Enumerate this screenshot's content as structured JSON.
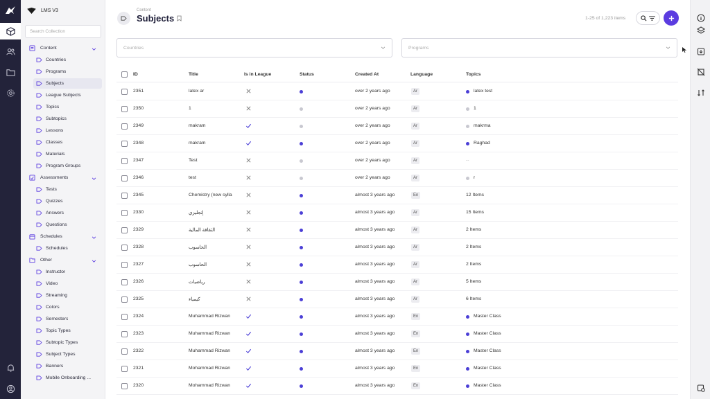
{
  "app": {
    "name": "LMS V3"
  },
  "search": {
    "placeholder": "Search Collection"
  },
  "sidebar": {
    "groups": [
      {
        "label": "Content",
        "items": [
          "Countries",
          "Programs",
          "Subjects",
          "League Subjects",
          "Topics",
          "Subtopics",
          "Lessons",
          "Classes",
          "Materials",
          "Program Groups"
        ]
      },
      {
        "label": "Assessments",
        "items": [
          "Tests",
          "Quizzes",
          "Answers",
          "Questions"
        ]
      },
      {
        "label": "Schedules",
        "items": [
          "Schedules"
        ]
      },
      {
        "label": "Other",
        "items": [
          "Instructor",
          "Video",
          "Streaming",
          "Colors",
          "Semesters",
          "Topic Types",
          "Subtopic Types",
          "Subject Types",
          "Banners",
          "Mobile Onboarding ..."
        ]
      }
    ],
    "active_item": "Subjects"
  },
  "header": {
    "breadcrumb": "Content",
    "title": "Subjects",
    "count": "1-25 of 1,223 items"
  },
  "filters": {
    "countries_placeholder": "Countries",
    "programs_placeholder": "Programs"
  },
  "table": {
    "columns": [
      "ID",
      "Title",
      "Is in League",
      "Status",
      "Created At",
      "Language",
      "Topics"
    ],
    "rows": [
      {
        "id": "2351",
        "title": "latex ar",
        "league": false,
        "status": "published",
        "created": "over 2 years ago",
        "lang": "Ar",
        "topics": "latex test",
        "topic_dot": "published"
      },
      {
        "id": "2350",
        "title": "1",
        "league": false,
        "status": "draft",
        "created": "over 2 years ago",
        "lang": "Ar",
        "topics": "1",
        "topic_dot": "draft"
      },
      {
        "id": "2349",
        "title": "makram",
        "league": true,
        "status": "draft",
        "created": "over 2 years ago",
        "lang": "Ar",
        "topics": "makrma",
        "topic_dot": "draft"
      },
      {
        "id": "2348",
        "title": "makram",
        "league": true,
        "status": "published",
        "created": "over 2 years ago",
        "lang": "Ar",
        "topics": "Raghad",
        "topic_dot": "published"
      },
      {
        "id": "2347",
        "title": "Test",
        "league": false,
        "status": "draft",
        "created": "over 2 years ago",
        "lang": "Ar",
        "topics": "--",
        "topic_dot": ""
      },
      {
        "id": "2346",
        "title": "test",
        "league": false,
        "status": "draft",
        "created": "over 2 years ago",
        "lang": "Ar",
        "topics": "r",
        "topic_dot": "draft"
      },
      {
        "id": "2345",
        "title": "Chemistry (new sylla",
        "league": false,
        "status": "published",
        "created": "almost 3 years ago",
        "lang": "En",
        "topics": "12 Items",
        "topic_dot": ""
      },
      {
        "id": "2330",
        "title": "إنجليزي",
        "league": false,
        "status": "published",
        "created": "almost 3 years ago",
        "lang": "Ar",
        "topics": "15 Items",
        "topic_dot": ""
      },
      {
        "id": "2329",
        "title": "الثقافة المالية",
        "league": false,
        "status": "published",
        "created": "almost 3 years ago",
        "lang": "Ar",
        "topics": "2 Items",
        "topic_dot": ""
      },
      {
        "id": "2328",
        "title": "الحاسوب",
        "league": false,
        "status": "published",
        "created": "almost 3 years ago",
        "lang": "Ar",
        "topics": "2 Items",
        "topic_dot": ""
      },
      {
        "id": "2327",
        "title": "الحاسوب",
        "league": false,
        "status": "published",
        "created": "almost 3 years ago",
        "lang": "Ar",
        "topics": "2 Items",
        "topic_dot": ""
      },
      {
        "id": "2326",
        "title": "رياضيات",
        "league": false,
        "status": "published",
        "created": "almost 3 years ago",
        "lang": "Ar",
        "topics": "5 Items",
        "topic_dot": ""
      },
      {
        "id": "2325",
        "title": "كيمياء",
        "league": false,
        "status": "published",
        "created": "almost 3 years ago",
        "lang": "Ar",
        "topics": "6 Items",
        "topic_dot": ""
      },
      {
        "id": "2324",
        "title": "Muhammad Rizwan",
        "league": true,
        "status": "published",
        "created": "almost 3 years ago",
        "lang": "En",
        "topics": "Master Class",
        "topic_dot": "published"
      },
      {
        "id": "2323",
        "title": "Muhammad Rizwan",
        "league": true,
        "status": "published",
        "created": "almost 3 years ago",
        "lang": "En",
        "topics": "Master Class",
        "topic_dot": "published"
      },
      {
        "id": "2322",
        "title": "Muhammad Rizwan",
        "league": true,
        "status": "published",
        "created": "almost 3 years ago",
        "lang": "En",
        "topics": "Master Class",
        "topic_dot": "published"
      },
      {
        "id": "2321",
        "title": "Mohammad Rizwan",
        "league": true,
        "status": "published",
        "created": "almost 3 years ago",
        "lang": "En",
        "topics": "Master Class",
        "topic_dot": "published"
      },
      {
        "id": "2320",
        "title": "Mohammad Rizwan",
        "league": true,
        "status": "published",
        "created": "almost 3 years ago",
        "lang": "En",
        "topics": "Master Class",
        "topic_dot": "published"
      }
    ]
  },
  "colors": {
    "accent": "#5b3ce0",
    "published": "#4b3fd6",
    "draft": "#c8c8d0"
  }
}
